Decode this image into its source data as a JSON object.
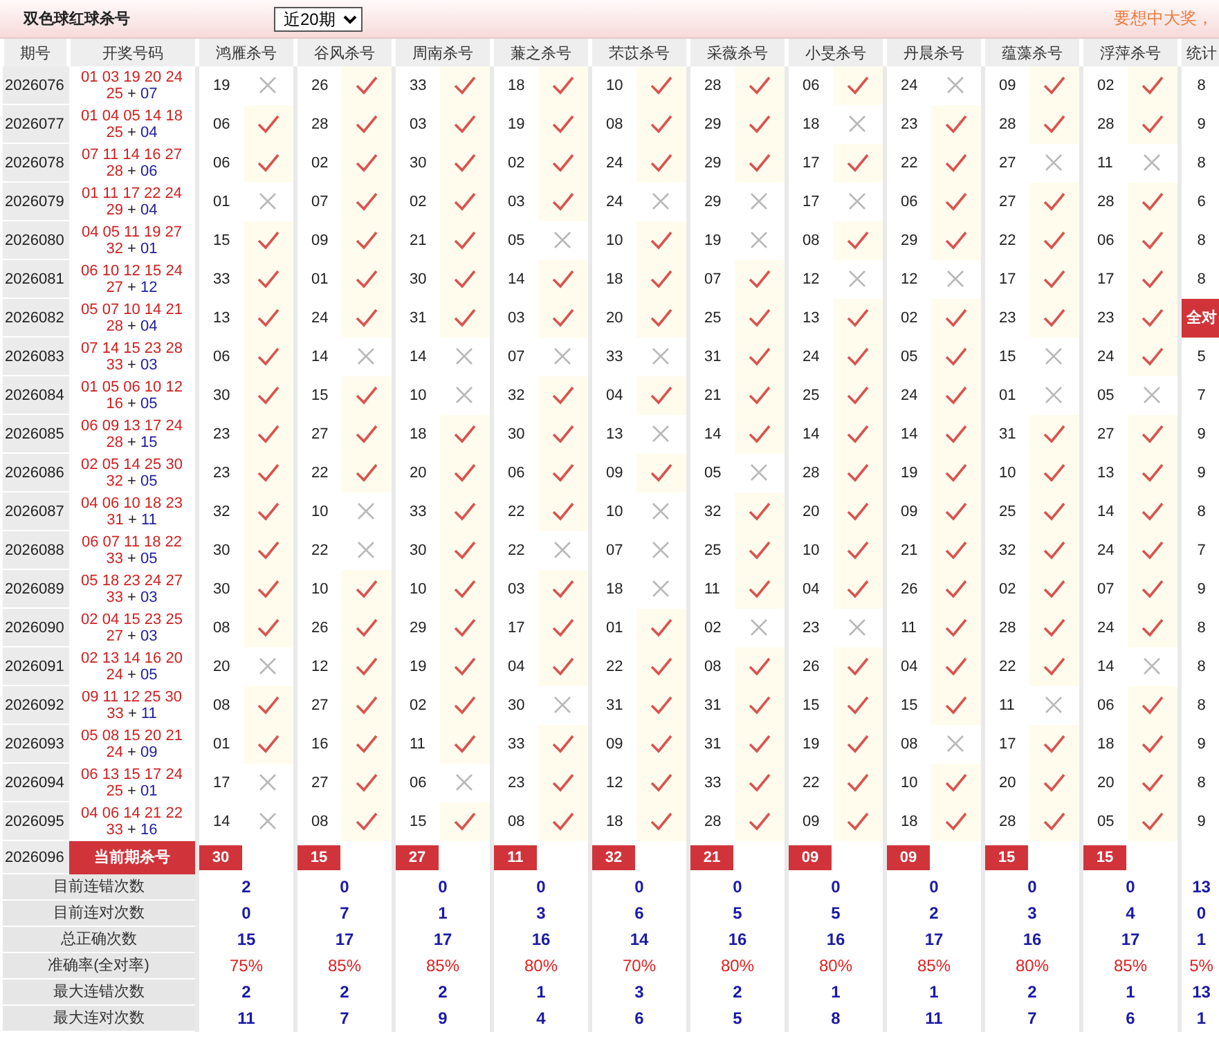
{
  "header": {
    "title": "双色球红球杀号",
    "period_select": "近20期",
    "slogan": "要想中大奖，"
  },
  "columns": {
    "period": "期号",
    "draw": "开奖号码",
    "experts": [
      "鸿雁杀号",
      "谷风杀号",
      "周南杀号",
      "蒹之杀号",
      "芣苡杀号",
      "采薇杀号",
      "小旻杀号",
      "丹晨杀号",
      "蕴藻杀号",
      "浮萍杀号"
    ],
    "stat": "统计"
  },
  "rows": [
    {
      "period": "2026076",
      "reds_line1": "01 03 19 20 24",
      "reds_line2": "25",
      "plus": "+",
      "blue": "07",
      "picks": [
        {
          "num": "19",
          "hit": false
        },
        {
          "num": "26",
          "hit": true
        },
        {
          "num": "33",
          "hit": true
        },
        {
          "num": "18",
          "hit": true
        },
        {
          "num": "10",
          "hit": true
        },
        {
          "num": "28",
          "hit": true
        },
        {
          "num": "06",
          "hit": true
        },
        {
          "num": "24",
          "hit": false
        },
        {
          "num": "09",
          "hit": true
        },
        {
          "num": "02",
          "hit": true
        }
      ],
      "stat": "8",
      "all_right": false
    },
    {
      "period": "2026077",
      "reds_line1": "01 04 05 14 18",
      "reds_line2": "25",
      "plus": "+",
      "blue": "04",
      "picks": [
        {
          "num": "06",
          "hit": true
        },
        {
          "num": "28",
          "hit": true
        },
        {
          "num": "03",
          "hit": true
        },
        {
          "num": "19",
          "hit": true
        },
        {
          "num": "08",
          "hit": true
        },
        {
          "num": "29",
          "hit": true
        },
        {
          "num": "18",
          "hit": false
        },
        {
          "num": "23",
          "hit": true
        },
        {
          "num": "28",
          "hit": true
        },
        {
          "num": "28",
          "hit": true
        }
      ],
      "stat": "9",
      "all_right": false
    },
    {
      "period": "2026078",
      "reds_line1": "07 11 14 16 27",
      "reds_line2": "28",
      "plus": "+",
      "blue": "06",
      "picks": [
        {
          "num": "06",
          "hit": true
        },
        {
          "num": "02",
          "hit": true
        },
        {
          "num": "30",
          "hit": true
        },
        {
          "num": "02",
          "hit": true
        },
        {
          "num": "24",
          "hit": true
        },
        {
          "num": "29",
          "hit": true
        },
        {
          "num": "17",
          "hit": true
        },
        {
          "num": "22",
          "hit": true
        },
        {
          "num": "27",
          "hit": false
        },
        {
          "num": "11",
          "hit": false
        }
      ],
      "stat": "8",
      "all_right": false
    },
    {
      "period": "2026079",
      "reds_line1": "01 11 17 22 24",
      "reds_line2": "29",
      "plus": "+",
      "blue": "04",
      "picks": [
        {
          "num": "01",
          "hit": false
        },
        {
          "num": "07",
          "hit": true
        },
        {
          "num": "02",
          "hit": true
        },
        {
          "num": "03",
          "hit": true
        },
        {
          "num": "24",
          "hit": false
        },
        {
          "num": "29",
          "hit": false
        },
        {
          "num": "17",
          "hit": false
        },
        {
          "num": "06",
          "hit": true
        },
        {
          "num": "27",
          "hit": true
        },
        {
          "num": "28",
          "hit": true
        }
      ],
      "stat": "6",
      "all_right": false
    },
    {
      "period": "2026080",
      "reds_line1": "04 05 11 19 27",
      "reds_line2": "32",
      "plus": "+",
      "blue": "01",
      "picks": [
        {
          "num": "15",
          "hit": true
        },
        {
          "num": "09",
          "hit": true
        },
        {
          "num": "21",
          "hit": true
        },
        {
          "num": "05",
          "hit": false
        },
        {
          "num": "10",
          "hit": true
        },
        {
          "num": "19",
          "hit": false
        },
        {
          "num": "08",
          "hit": true
        },
        {
          "num": "29",
          "hit": true
        },
        {
          "num": "22",
          "hit": true
        },
        {
          "num": "06",
          "hit": true
        }
      ],
      "stat": "8",
      "all_right": false
    },
    {
      "period": "2026081",
      "reds_line1": "06 10 12 15 24",
      "reds_line2": "27",
      "plus": "+",
      "blue": "12",
      "picks": [
        {
          "num": "33",
          "hit": true
        },
        {
          "num": "01",
          "hit": true
        },
        {
          "num": "30",
          "hit": true
        },
        {
          "num": "14",
          "hit": true
        },
        {
          "num": "18",
          "hit": true
        },
        {
          "num": "07",
          "hit": true
        },
        {
          "num": "12",
          "hit": false
        },
        {
          "num": "12",
          "hit": false
        },
        {
          "num": "17",
          "hit": true
        },
        {
          "num": "17",
          "hit": true
        }
      ],
      "stat": "8",
      "all_right": false
    },
    {
      "period": "2026082",
      "reds_line1": "05 07 10 14 21",
      "reds_line2": "28",
      "plus": "+",
      "blue": "04",
      "picks": [
        {
          "num": "13",
          "hit": true
        },
        {
          "num": "24",
          "hit": true
        },
        {
          "num": "31",
          "hit": true
        },
        {
          "num": "03",
          "hit": true
        },
        {
          "num": "20",
          "hit": true
        },
        {
          "num": "25",
          "hit": true
        },
        {
          "num": "13",
          "hit": true
        },
        {
          "num": "02",
          "hit": true
        },
        {
          "num": "23",
          "hit": true
        },
        {
          "num": "23",
          "hit": true
        }
      ],
      "stat": "全对",
      "all_right": true
    },
    {
      "period": "2026083",
      "reds_line1": "07 14 15 23 28",
      "reds_line2": "33",
      "plus": "+",
      "blue": "03",
      "picks": [
        {
          "num": "06",
          "hit": true
        },
        {
          "num": "14",
          "hit": false
        },
        {
          "num": "14",
          "hit": false
        },
        {
          "num": "07",
          "hit": false
        },
        {
          "num": "33",
          "hit": false
        },
        {
          "num": "31",
          "hit": true
        },
        {
          "num": "24",
          "hit": true
        },
        {
          "num": "05",
          "hit": true
        },
        {
          "num": "15",
          "hit": false
        },
        {
          "num": "24",
          "hit": true
        }
      ],
      "stat": "5",
      "all_right": false
    },
    {
      "period": "2026084",
      "reds_line1": "01 05 06 10 12",
      "reds_line2": "16",
      "plus": "+",
      "blue": "05",
      "picks": [
        {
          "num": "30",
          "hit": true
        },
        {
          "num": "15",
          "hit": true
        },
        {
          "num": "10",
          "hit": false
        },
        {
          "num": "32",
          "hit": true
        },
        {
          "num": "04",
          "hit": true
        },
        {
          "num": "21",
          "hit": true
        },
        {
          "num": "25",
          "hit": true
        },
        {
          "num": "24",
          "hit": true
        },
        {
          "num": "01",
          "hit": false
        },
        {
          "num": "05",
          "hit": false
        }
      ],
      "stat": "7",
      "all_right": false
    },
    {
      "period": "2026085",
      "reds_line1": "06 09 13 17 24",
      "reds_line2": "28",
      "plus": "+",
      "blue": "15",
      "picks": [
        {
          "num": "23",
          "hit": true
        },
        {
          "num": "27",
          "hit": true
        },
        {
          "num": "18",
          "hit": true
        },
        {
          "num": "30",
          "hit": true
        },
        {
          "num": "13",
          "hit": false
        },
        {
          "num": "14",
          "hit": true
        },
        {
          "num": "14",
          "hit": true
        },
        {
          "num": "14",
          "hit": true
        },
        {
          "num": "31",
          "hit": true
        },
        {
          "num": "27",
          "hit": true
        }
      ],
      "stat": "9",
      "all_right": false
    },
    {
      "period": "2026086",
      "reds_line1": "02 05 14 25 30",
      "reds_line2": "32",
      "plus": "+",
      "blue": "05",
      "picks": [
        {
          "num": "23",
          "hit": true
        },
        {
          "num": "22",
          "hit": true
        },
        {
          "num": "20",
          "hit": true
        },
        {
          "num": "06",
          "hit": true
        },
        {
          "num": "09",
          "hit": true
        },
        {
          "num": "05",
          "hit": false
        },
        {
          "num": "28",
          "hit": true
        },
        {
          "num": "19",
          "hit": true
        },
        {
          "num": "10",
          "hit": true
        },
        {
          "num": "13",
          "hit": true
        }
      ],
      "stat": "9",
      "all_right": false
    },
    {
      "period": "2026087",
      "reds_line1": "04 06 10 18 23",
      "reds_line2": "31",
      "plus": "+",
      "blue": "11",
      "picks": [
        {
          "num": "32",
          "hit": true
        },
        {
          "num": "10",
          "hit": false
        },
        {
          "num": "33",
          "hit": true
        },
        {
          "num": "22",
          "hit": true
        },
        {
          "num": "10",
          "hit": false
        },
        {
          "num": "32",
          "hit": true
        },
        {
          "num": "20",
          "hit": true
        },
        {
          "num": "09",
          "hit": true
        },
        {
          "num": "25",
          "hit": true
        },
        {
          "num": "14",
          "hit": true
        }
      ],
      "stat": "8",
      "all_right": false
    },
    {
      "period": "2026088",
      "reds_line1": "06 07 11 18 22",
      "reds_line2": "33",
      "plus": "+",
      "blue": "05",
      "picks": [
        {
          "num": "30",
          "hit": true
        },
        {
          "num": "22",
          "hit": false
        },
        {
          "num": "30",
          "hit": true
        },
        {
          "num": "22",
          "hit": false
        },
        {
          "num": "07",
          "hit": false
        },
        {
          "num": "25",
          "hit": true
        },
        {
          "num": "10",
          "hit": true
        },
        {
          "num": "21",
          "hit": true
        },
        {
          "num": "32",
          "hit": true
        },
        {
          "num": "24",
          "hit": true
        }
      ],
      "stat": "7",
      "all_right": false
    },
    {
      "period": "2026089",
      "reds_line1": "05 18 23 24 27",
      "reds_line2": "33",
      "plus": "+",
      "blue": "03",
      "picks": [
        {
          "num": "30",
          "hit": true
        },
        {
          "num": "10",
          "hit": true
        },
        {
          "num": "10",
          "hit": true
        },
        {
          "num": "03",
          "hit": true
        },
        {
          "num": "18",
          "hit": false
        },
        {
          "num": "11",
          "hit": true
        },
        {
          "num": "04",
          "hit": true
        },
        {
          "num": "26",
          "hit": true
        },
        {
          "num": "02",
          "hit": true
        },
        {
          "num": "07",
          "hit": true
        }
      ],
      "stat": "9",
      "all_right": false
    },
    {
      "period": "2026090",
      "reds_line1": "02 04 15 23 25",
      "reds_line2": "27",
      "plus": "+",
      "blue": "03",
      "picks": [
        {
          "num": "08",
          "hit": true
        },
        {
          "num": "26",
          "hit": true
        },
        {
          "num": "29",
          "hit": true
        },
        {
          "num": "17",
          "hit": true
        },
        {
          "num": "01",
          "hit": true
        },
        {
          "num": "02",
          "hit": false
        },
        {
          "num": "23",
          "hit": false
        },
        {
          "num": "11",
          "hit": true
        },
        {
          "num": "28",
          "hit": true
        },
        {
          "num": "24",
          "hit": true
        }
      ],
      "stat": "8",
      "all_right": false
    },
    {
      "period": "2026091",
      "reds_line1": "02 13 14 16 20",
      "reds_line2": "24",
      "plus": "+",
      "blue": "05",
      "picks": [
        {
          "num": "20",
          "hit": false
        },
        {
          "num": "12",
          "hit": true
        },
        {
          "num": "19",
          "hit": true
        },
        {
          "num": "04",
          "hit": true
        },
        {
          "num": "22",
          "hit": true
        },
        {
          "num": "08",
          "hit": true
        },
        {
          "num": "26",
          "hit": true
        },
        {
          "num": "04",
          "hit": true
        },
        {
          "num": "22",
          "hit": true
        },
        {
          "num": "14",
          "hit": false
        }
      ],
      "stat": "8",
      "all_right": false
    },
    {
      "period": "2026092",
      "reds_line1": "09 11 12 25 30",
      "reds_line2": "33",
      "plus": "+",
      "blue": "11",
      "picks": [
        {
          "num": "08",
          "hit": true
        },
        {
          "num": "27",
          "hit": true
        },
        {
          "num": "02",
          "hit": true
        },
        {
          "num": "30",
          "hit": false
        },
        {
          "num": "31",
          "hit": true
        },
        {
          "num": "31",
          "hit": true
        },
        {
          "num": "15",
          "hit": true
        },
        {
          "num": "15",
          "hit": true
        },
        {
          "num": "11",
          "hit": false
        },
        {
          "num": "06",
          "hit": true
        }
      ],
      "stat": "8",
      "all_right": false
    },
    {
      "period": "2026093",
      "reds_line1": "05 08 15 20 21",
      "reds_line2": "24",
      "plus": "+",
      "blue": "09",
      "picks": [
        {
          "num": "01",
          "hit": true
        },
        {
          "num": "16",
          "hit": true
        },
        {
          "num": "11",
          "hit": true
        },
        {
          "num": "33",
          "hit": true
        },
        {
          "num": "09",
          "hit": true
        },
        {
          "num": "31",
          "hit": true
        },
        {
          "num": "19",
          "hit": true
        },
        {
          "num": "08",
          "hit": false
        },
        {
          "num": "17",
          "hit": true
        },
        {
          "num": "18",
          "hit": true
        }
      ],
      "stat": "9",
      "all_right": false
    },
    {
      "period": "2026094",
      "reds_line1": "06 13 15 17 24",
      "reds_line2": "25",
      "plus": "+",
      "blue": "01",
      "picks": [
        {
          "num": "17",
          "hit": false
        },
        {
          "num": "27",
          "hit": true
        },
        {
          "num": "06",
          "hit": false
        },
        {
          "num": "23",
          "hit": true
        },
        {
          "num": "12",
          "hit": true
        },
        {
          "num": "33",
          "hit": true
        },
        {
          "num": "22",
          "hit": true
        },
        {
          "num": "10",
          "hit": true
        },
        {
          "num": "20",
          "hit": true
        },
        {
          "num": "20",
          "hit": true
        }
      ],
      "stat": "8",
      "all_right": false
    },
    {
      "period": "2026095",
      "reds_line1": "04 06 14 21 22",
      "reds_line2": "33",
      "plus": "+",
      "blue": "16",
      "picks": [
        {
          "num": "14",
          "hit": false
        },
        {
          "num": "08",
          "hit": true
        },
        {
          "num": "15",
          "hit": true
        },
        {
          "num": "08",
          "hit": true
        },
        {
          "num": "18",
          "hit": true
        },
        {
          "num": "28",
          "hit": true
        },
        {
          "num": "09",
          "hit": true
        },
        {
          "num": "18",
          "hit": true
        },
        {
          "num": "28",
          "hit": true
        },
        {
          "num": "05",
          "hit": true
        }
      ],
      "stat": "9",
      "all_right": false
    }
  ],
  "current": {
    "period": "2026096",
    "label": "当前期杀号",
    "picks": [
      "30",
      "15",
      "27",
      "11",
      "32",
      "21",
      "09",
      "09",
      "15",
      "15"
    ]
  },
  "stats": [
    {
      "label": "目前连错次数",
      "kind": "count",
      "values": [
        "2",
        "0",
        "0",
        "0",
        "0",
        "0",
        "0",
        "0",
        "0",
        "0"
      ],
      "stat": "13"
    },
    {
      "label": "目前连对次数",
      "kind": "count",
      "values": [
        "0",
        "7",
        "1",
        "3",
        "6",
        "5",
        "5",
        "2",
        "3",
        "4"
      ],
      "stat": "0"
    },
    {
      "label": "总正确次数",
      "kind": "count",
      "values": [
        "15",
        "17",
        "17",
        "16",
        "14",
        "16",
        "16",
        "17",
        "16",
        "17"
      ],
      "stat": "1"
    },
    {
      "label": "准确率(全对率)",
      "kind": "percent",
      "values": [
        "75%",
        "85%",
        "85%",
        "80%",
        "70%",
        "80%",
        "80%",
        "85%",
        "80%",
        "85%"
      ],
      "stat": "5%"
    },
    {
      "label": "最大连错次数",
      "kind": "count",
      "values": [
        "2",
        "2",
        "2",
        "1",
        "3",
        "2",
        "1",
        "1",
        "2",
        "1"
      ],
      "stat": "13"
    },
    {
      "label": "最大连对次数",
      "kind": "count",
      "values": [
        "11",
        "7",
        "9",
        "4",
        "6",
        "5",
        "8",
        "11",
        "7",
        "6"
      ],
      "stat": "1"
    }
  ]
}
